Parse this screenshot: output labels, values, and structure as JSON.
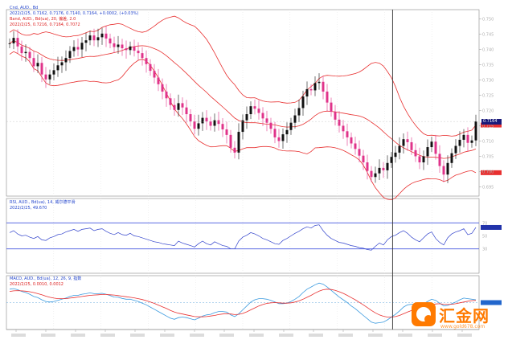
{
  "main_panel": {
    "title": "Cnd, AUD., Bd",
    "header_lines": [
      {
        "text": "2022/2/25, 0.7162, 0.7176, 0.7140, 0.7164, +0.0002, (+0.03%)",
        "color": "#2244cc"
      },
      {
        "text": "Band, AUD., Bd(ua), 20, 偏差, 2.0",
        "color": "#dd2222"
      },
      {
        "text": "2022/2/25, 0.7216, 0.7164, 0.7072",
        "color": "#dd2222"
      }
    ],
    "last_price_tag": "0.7164"
  },
  "rsi_panel": {
    "header_lines": [
      {
        "text": "RSI, AUD., Bd(ua), 14, 威尔德平滑",
        "color": "#2244cc"
      },
      {
        "text": "2022/2/25, 49.670",
        "color": "#2244cc"
      }
    ]
  },
  "macd_panel": {
    "header_lines": [
      {
        "text": "MACD, AUD., Bd(ua), 12, 26, 9, 指数",
        "color": "#2244cc"
      },
      {
        "text": "2022/2/25, 0.0010, 0.0012",
        "color": "#dd2222"
      }
    ]
  },
  "watermark": {
    "brand": "汇金网",
    "url": "www.gold678.com"
  },
  "colors": {
    "bull": "#111111",
    "bear": "#e0338a",
    "band": "#e83030",
    "rsi": "#3344cc",
    "macd": "#3a9adf",
    "signal": "#e83030",
    "axis": "#999999"
  },
  "chart_data": [
    {
      "type": "candlestick",
      "series": [
        {
          "name": "AUD",
          "close": [
            0.742,
            0.7438,
            0.741,
            0.7388,
            0.7392,
            0.7372,
            0.7345,
            0.7356,
            0.7318,
            0.7302,
            0.7318,
            0.7332,
            0.7348,
            0.7358,
            0.7372,
            0.7395,
            0.7408,
            0.74,
            0.7422,
            0.743,
            0.7446,
            0.743,
            0.744,
            0.7452,
            0.7436,
            0.742,
            0.7408,
            0.7416,
            0.7404,
            0.7398,
            0.741,
            0.7396,
            0.7388,
            0.7372,
            0.7352,
            0.733,
            0.7308,
            0.7286,
            0.7262,
            0.724,
            0.7218,
            0.7202,
            0.7224,
            0.721,
            0.7188,
            0.7164,
            0.714,
            0.7158,
            0.7176,
            0.7164,
            0.715,
            0.7168,
            0.7156,
            0.7138,
            0.712,
            0.7078,
            0.7062,
            0.713,
            0.7168,
            0.7188,
            0.7214,
            0.7206,
            0.7192,
            0.7174,
            0.716,
            0.714,
            0.7112,
            0.71,
            0.7122,
            0.7136,
            0.716,
            0.7184,
            0.7208,
            0.7246,
            0.727,
            0.7266,
            0.729,
            0.7294,
            0.7262,
            0.7226,
            0.7196,
            0.717,
            0.715,
            0.7132,
            0.7112,
            0.7092,
            0.7074,
            0.7052,
            0.703,
            0.7002,
            0.6982,
            0.6994,
            0.7012,
            0.7004,
            0.7028,
            0.7048,
            0.7062,
            0.7084,
            0.7106,
            0.7096,
            0.707,
            0.705,
            0.703,
            0.705,
            0.708,
            0.7098,
            0.7058,
            0.7018,
            0.699,
            0.7028,
            0.706,
            0.7084,
            0.7104,
            0.712,
            0.7094,
            0.7102,
            0.7164
          ]
        }
      ]
    },
    {
      "type": "line",
      "title": "RSI 14",
      "series": [
        {
          "name": "RSI",
          "values": [
            55,
            58,
            53,
            50,
            51,
            48,
            46,
            49,
            44,
            43,
            47,
            49,
            52,
            53,
            56,
            58,
            60,
            57,
            60,
            61,
            62,
            58,
            60,
            61,
            57,
            54,
            52,
            55,
            52,
            51,
            54,
            50,
            49,
            47,
            45,
            43,
            41,
            40,
            38,
            37,
            36,
            35,
            42,
            39,
            37,
            35,
            33,
            38,
            42,
            38,
            36,
            41,
            38,
            35,
            34,
            30,
            30,
            42,
            48,
            51,
            55,
            53,
            50,
            46,
            44,
            41,
            38,
            37,
            43,
            46,
            50,
            54,
            57,
            61,
            64,
            62,
            66,
            67,
            58,
            51,
            46,
            43,
            40,
            39,
            37,
            35,
            34,
            32,
            31,
            29,
            28,
            34,
            39,
            36,
            44,
            49,
            51,
            55,
            58,
            54,
            48,
            44,
            41,
            47,
            53,
            56,
            46,
            40,
            36,
            47,
            53,
            56,
            58,
            61,
            52,
            54,
            63
          ]
        }
      ],
      "levels": [
        70,
        30
      ]
    },
    {
      "type": "line",
      "title": "MACD 12 26 9",
      "series": [
        {
          "name": "MACD",
          "values": [
            0.0048,
            0.005,
            0.0046,
            0.004,
            0.0036,
            0.003,
            0.0022,
            0.0018,
            0.001,
            0.0004,
            0.0002,
            0.0004,
            0.0008,
            0.0012,
            0.0016,
            0.0022,
            0.0026,
            0.0026,
            0.003,
            0.0032,
            0.0035,
            0.0032,
            0.0032,
            0.0033,
            0.003,
            0.0025,
            0.002,
            0.0019,
            0.0015,
            0.0012,
            0.0012,
            0.0008,
            0.0004,
            -0.0002,
            -0.0008,
            -0.0016,
            -0.0024,
            -0.0032,
            -0.004,
            -0.0048,
            -0.0056,
            -0.006,
            -0.0054,
            -0.0052,
            -0.0054,
            -0.0058,
            -0.0062,
            -0.0056,
            -0.0048,
            -0.0044,
            -0.0042,
            -0.0036,
            -0.0032,
            -0.0032,
            -0.0034,
            -0.0044,
            -0.005,
            -0.004,
            -0.0026,
            -0.0012,
            0.0002,
            0.001,
            0.0014,
            0.0014,
            0.0012,
            0.0008,
            0.0002,
            -0.0004,
            -0.0004,
            -0.0002,
            0.0004,
            0.0012,
            0.0022,
            0.0036,
            0.0048,
            0.0056,
            0.0064,
            0.007,
            0.0066,
            0.0056,
            0.0044,
            0.0032,
            0.002,
            0.001,
            0.0,
            -0.0012,
            -0.0022,
            -0.0034,
            -0.0046,
            -0.0058,
            -0.007,
            -0.0074,
            -0.0072,
            -0.007,
            -0.0062,
            -0.0052,
            -0.0042,
            -0.003,
            -0.0016,
            -0.0008,
            -0.0006,
            -0.0006,
            -0.0008,
            -0.0004,
            0.0004,
            0.0012,
            0.0008,
            -0.0002,
            -0.0012,
            -0.001,
            -0.0004,
            0.0002,
            0.001,
            0.0016,
            0.0014,
            0.0012,
            0.001
          ]
        },
        {
          "name": "Signal",
          "values": [
            0.004,
            0.0042,
            0.0043,
            0.0042,
            0.0041,
            0.0039,
            0.0036,
            0.0032,
            0.0028,
            0.0023,
            0.0019,
            0.0016,
            0.0014,
            0.0014,
            0.0014,
            0.0016,
            0.0018,
            0.002,
            0.0022,
            0.0024,
            0.0026,
            0.0027,
            0.0028,
            0.0029,
            0.0029,
            0.0028,
            0.0027,
            0.0025,
            0.0023,
            0.0021,
            0.0019,
            0.0017,
            0.0014,
            0.0011,
            0.0007,
            0.0002,
            -0.0003,
            -0.0009,
            -0.0015,
            -0.0021,
            -0.0028,
            -0.0034,
            -0.0038,
            -0.0041,
            -0.0044,
            -0.0047,
            -0.005,
            -0.0051,
            -0.0051,
            -0.005,
            -0.0048,
            -0.0046,
            -0.0043,
            -0.0041,
            -0.004,
            -0.0041,
            -0.0043,
            -0.0042,
            -0.0039,
            -0.0033,
            -0.0026,
            -0.0019,
            -0.0012,
            -0.0007,
            -0.0003,
            -0.0001,
            0.0,
            -0.0001,
            -0.0002,
            -0.0002,
            -0.0001,
            0.0002,
            0.0006,
            0.0012,
            0.0019,
            0.0026,
            0.0034,
            0.0041,
            0.0046,
            0.0048,
            0.0047,
            0.0044,
            0.0039,
            0.0033,
            0.0026,
            0.0018,
            0.001,
            0.0001,
            -0.0008,
            -0.0018,
            -0.0028,
            -0.0037,
            -0.0044,
            -0.0049,
            -0.0052,
            -0.0052,
            -0.005,
            -0.0046,
            -0.004,
            -0.0034,
            -0.0028,
            -0.0024,
            -0.0021,
            -0.0018,
            -0.0014,
            -0.0009,
            -0.0005,
            -0.0004,
            -0.0006,
            -0.0007,
            -0.0006,
            -0.0004,
            -0.0001,
            0.0002,
            0.0005,
            0.0007,
            0.0008
          ]
        }
      ]
    }
  ]
}
